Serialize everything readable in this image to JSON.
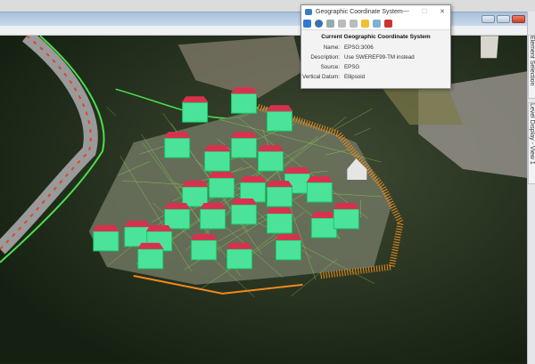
{
  "dialog": {
    "title": "Geographic Coordinate System",
    "minimize": "—",
    "maximize": "☐",
    "close": "✕",
    "toolbar_icons": [
      "info-icon",
      "from-library-icon",
      "pin-icon",
      "copy-icon",
      "paste-icon",
      "lock-icon",
      "report-icon",
      "delete-icon"
    ],
    "heading": "Current Geographic Coordinate System",
    "fields": [
      {
        "label": "Name:",
        "value": "EPSG:3006"
      },
      {
        "label": "Description:",
        "value": "Use SWEREF99-TM instead"
      },
      {
        "label": "Source:",
        "value": "EPSG"
      },
      {
        "label": "Vertical Datum:",
        "value": "Ellipsoid"
      }
    ]
  },
  "side_tabs": [
    {
      "label": "Element Selection"
    },
    {
      "label": "Level Display - View 1"
    }
  ],
  "colors": {
    "building": "#4be39a",
    "roof": "#d8314f",
    "fence": "#f08a1a",
    "mesh": "#9ef05a"
  }
}
